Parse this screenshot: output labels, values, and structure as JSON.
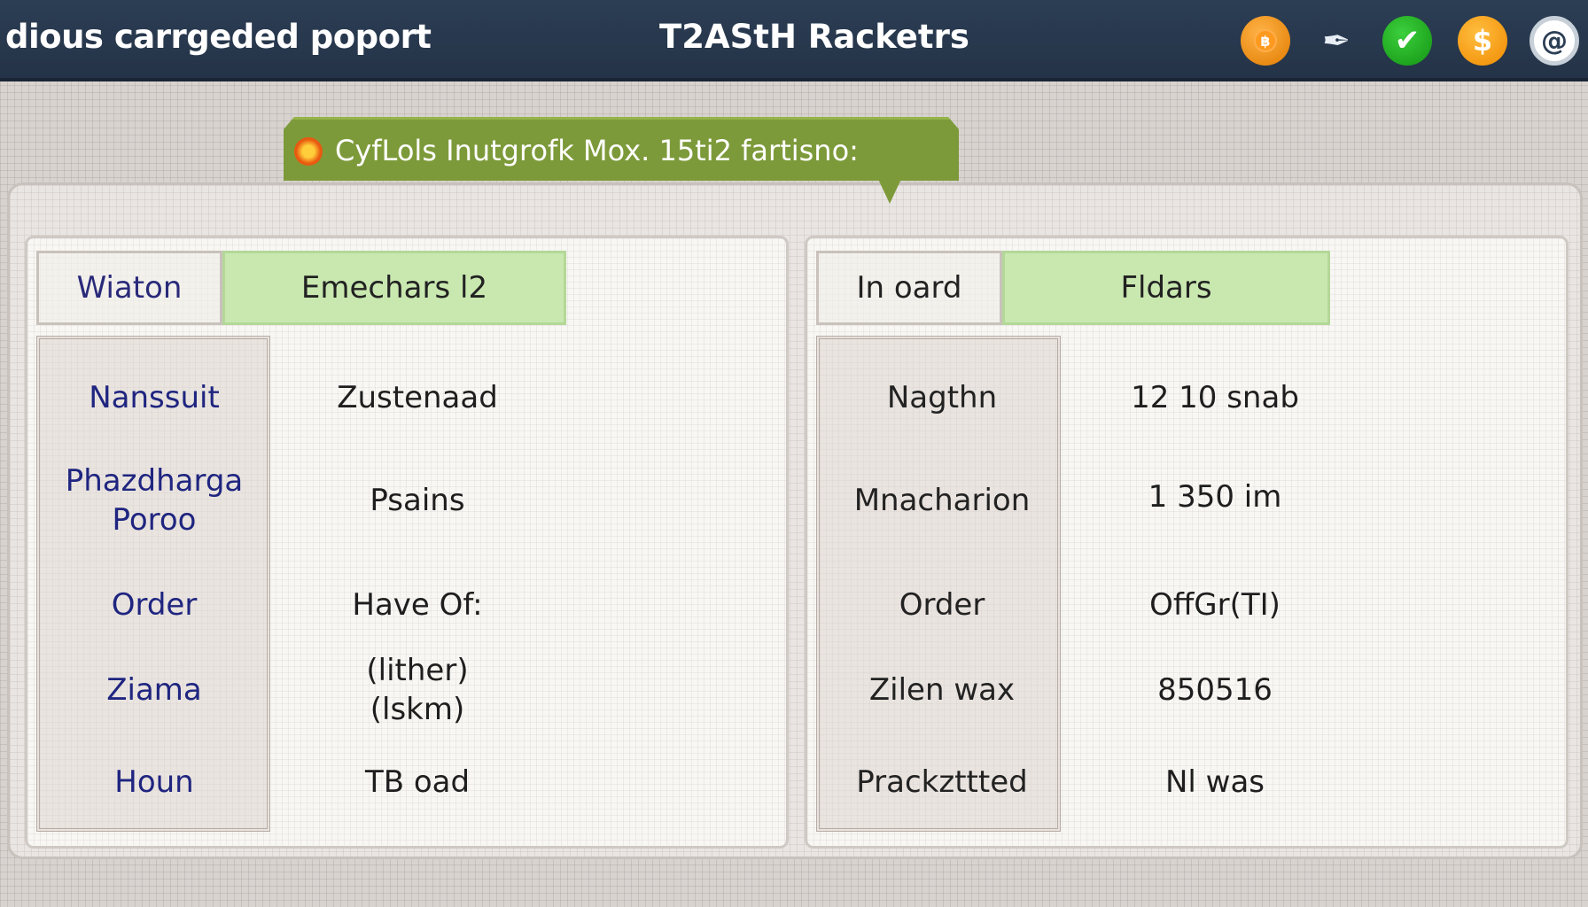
{
  "window": {
    "left_title": "dious carrgeded poport",
    "center_title": "T2AStH Racketrs"
  },
  "toolbar_icons": [
    {
      "name": "coin-icon",
      "glyph": "฿",
      "color": "#f08a00"
    },
    {
      "name": "pen-icon",
      "glyph": "✒",
      "color": "#e8eef5"
    },
    {
      "name": "check-icon",
      "glyph": "✔",
      "color": "#1aa11a"
    },
    {
      "name": "dollar-icon",
      "glyph": "$",
      "color": "#f59a10"
    },
    {
      "name": "at-icon",
      "glyph": "@",
      "color": "#ffffff"
    }
  ],
  "banner": {
    "text": "CyfLols Inutgrofk Mox. 15ti2 fartisno:",
    "accent": "#7d9a3a"
  },
  "left_card": {
    "header_label": "Wiaton",
    "header_value": "Emechars l2",
    "rows": [
      {
        "label": "Nanssuit",
        "value": "Zustenaad"
      },
      {
        "label": "Phazdharga Poroo",
        "value": "Psains"
      },
      {
        "label": "Order",
        "value": "Have Of:"
      },
      {
        "label": "Ziama",
        "value": "(lither) (lskm)"
      },
      {
        "label": "Houn",
        "value": "TB oad"
      }
    ]
  },
  "right_card": {
    "header_label": "In oard",
    "header_value": "Fldars",
    "rows": [
      {
        "label": "Nagthn",
        "value": "12 10 snab"
      },
      {
        "label": "Mnacharion",
        "value": "1 350 im"
      },
      {
        "label": "Order",
        "value": "OffGr(TI)"
      },
      {
        "label": "Zilen wax",
        "value": "850516"
      },
      {
        "label": "Prackzttted",
        "value": "Nl was"
      }
    ]
  }
}
